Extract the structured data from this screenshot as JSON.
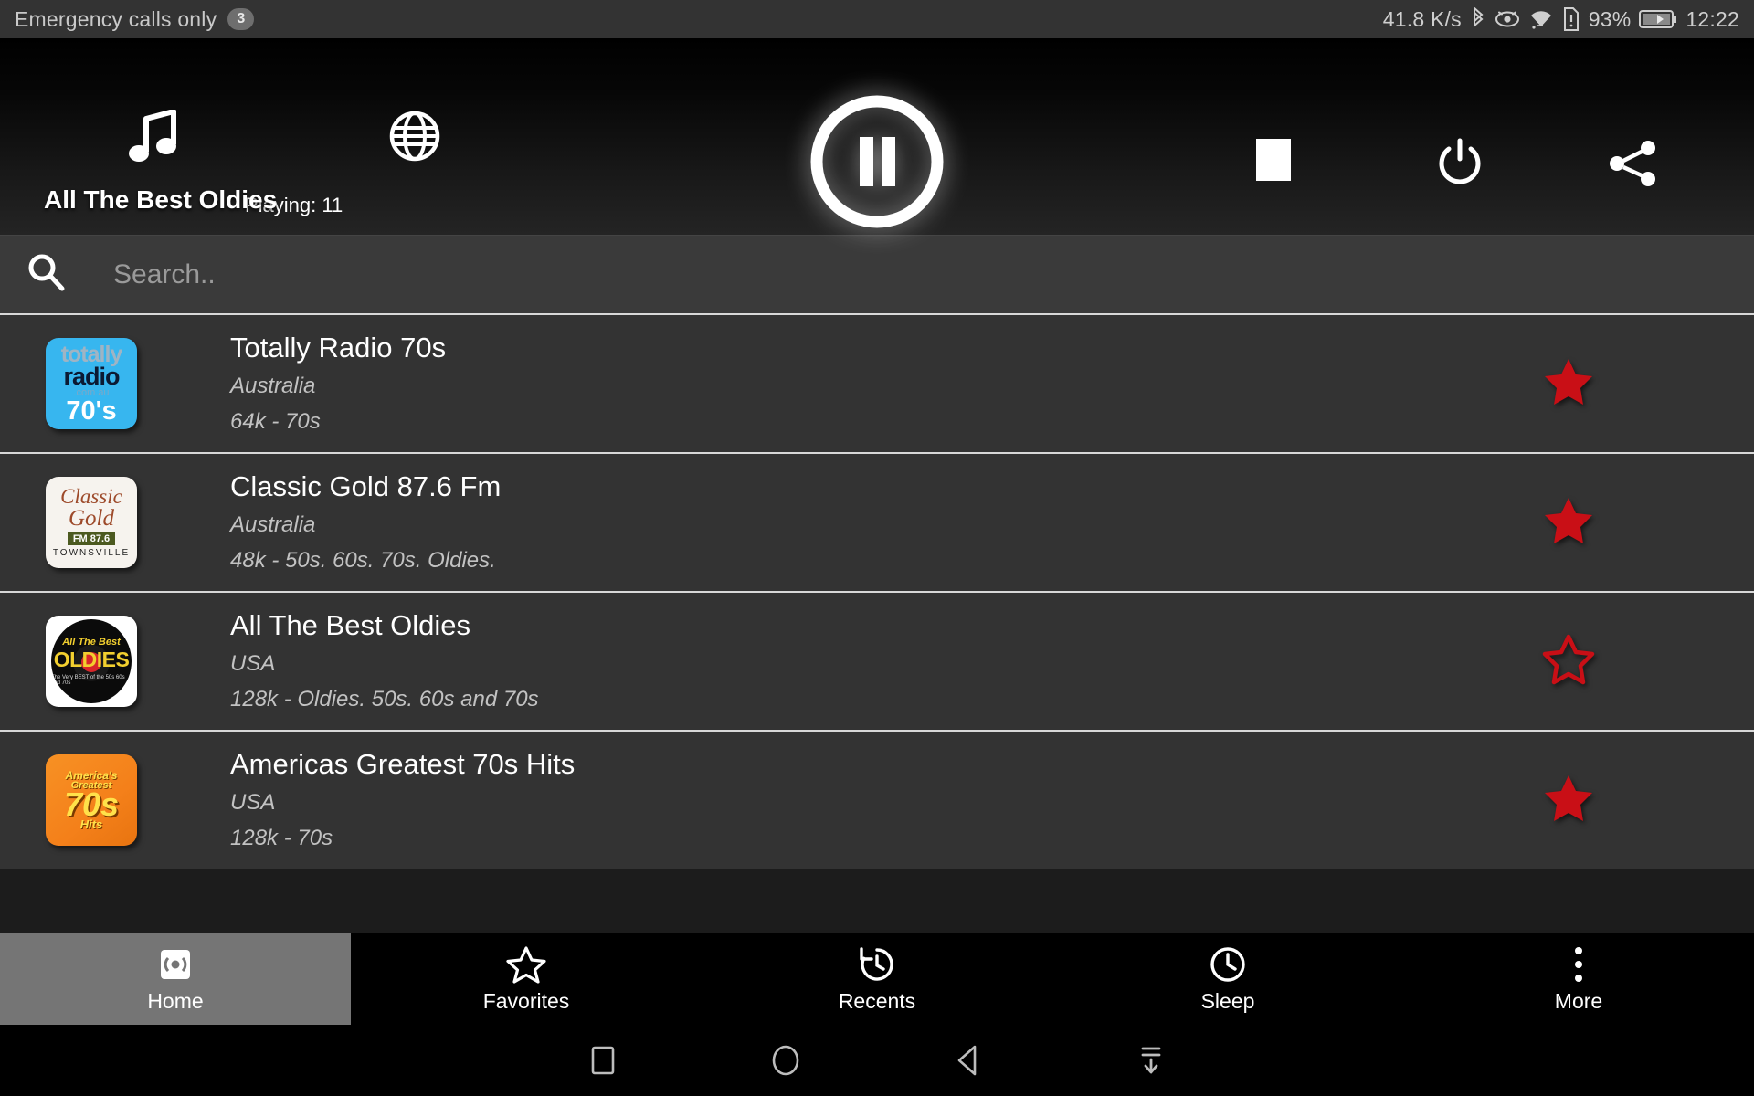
{
  "status_bar": {
    "carrier_text": "Emergency calls only",
    "badge": "3",
    "network_speed": "41.8 K/s",
    "battery_percent": "93%",
    "clock": "12:22",
    "icons": [
      "bluetooth-icon",
      "eye-icon",
      "wifi-icon",
      "sim-alert-icon",
      "battery-charging-icon"
    ]
  },
  "player": {
    "music_icon": "music-note-icon",
    "globe_icon": "globe-icon",
    "playing_label": "Playing: 11",
    "pause_icon": "pause-circle-icon",
    "stop_icon": "stop-square-icon",
    "power_icon": "power-icon",
    "share_icon": "share-icon",
    "station_title": "All The Best Oldies"
  },
  "search": {
    "icon": "search-icon",
    "placeholder": "Search..",
    "value": ""
  },
  "stations": [
    {
      "name": "Totally Radio 70s",
      "country": "Australia",
      "meta": "64k - 70s",
      "favorite": true,
      "logo": "totally-radio-70s-logo",
      "logo_lines": {
        "l1": "totally",
        "l2": "radio",
        "l3": ".com.au",
        "l4": "70's"
      }
    },
    {
      "name": "Classic Gold 87.6 Fm",
      "country": "Australia",
      "meta": "48k - 50s. 60s. 70s. Oldies.",
      "favorite": true,
      "logo": "classic-gold-logo",
      "logo_lines": {
        "c1": "Classic",
        "c2": "Gold",
        "c3": "FM 87.6",
        "c4": "TOWNSVILLE"
      }
    },
    {
      "name": "All The Best Oldies",
      "country": "USA",
      "meta": "128k - Oldies. 50s. 60s and 70s",
      "favorite": false,
      "logo": "all-the-best-oldies-logo",
      "logo_lines": {
        "o1": "All The Best",
        "o2": "OLDIES",
        "o3": "The Very BEST of the 50s 60s and 70s"
      }
    },
    {
      "name": "Americas Greatest 70s Hits",
      "country": "USA",
      "meta": "128k - 70s",
      "favorite": true,
      "logo": "americas-greatest-70s-hits-logo",
      "logo_lines": {
        "a1": "America's",
        "a2": "Greatest",
        "a3": "70s",
        "a4": "Hits"
      }
    }
  ],
  "tabs": [
    {
      "label": "Home",
      "icon": "radio-broadcast-icon",
      "active": true
    },
    {
      "label": "Favorites",
      "icon": "star-outline-icon",
      "active": false
    },
    {
      "label": "Recents",
      "icon": "history-icon",
      "active": false
    },
    {
      "label": "Sleep",
      "icon": "clock-icon",
      "active": false
    },
    {
      "label": "More",
      "icon": "overflow-menu-icon",
      "active": false
    }
  ],
  "system_nav": [
    {
      "icon": "recents-square-icon"
    },
    {
      "icon": "home-circle-icon"
    },
    {
      "icon": "back-triangle-icon"
    },
    {
      "icon": "hide-keyboard-icon"
    }
  ],
  "colors": {
    "favorite_star": "#c90f16",
    "header_bg": "#000000",
    "list_bg": "#333333",
    "active_tab": "#757575"
  }
}
